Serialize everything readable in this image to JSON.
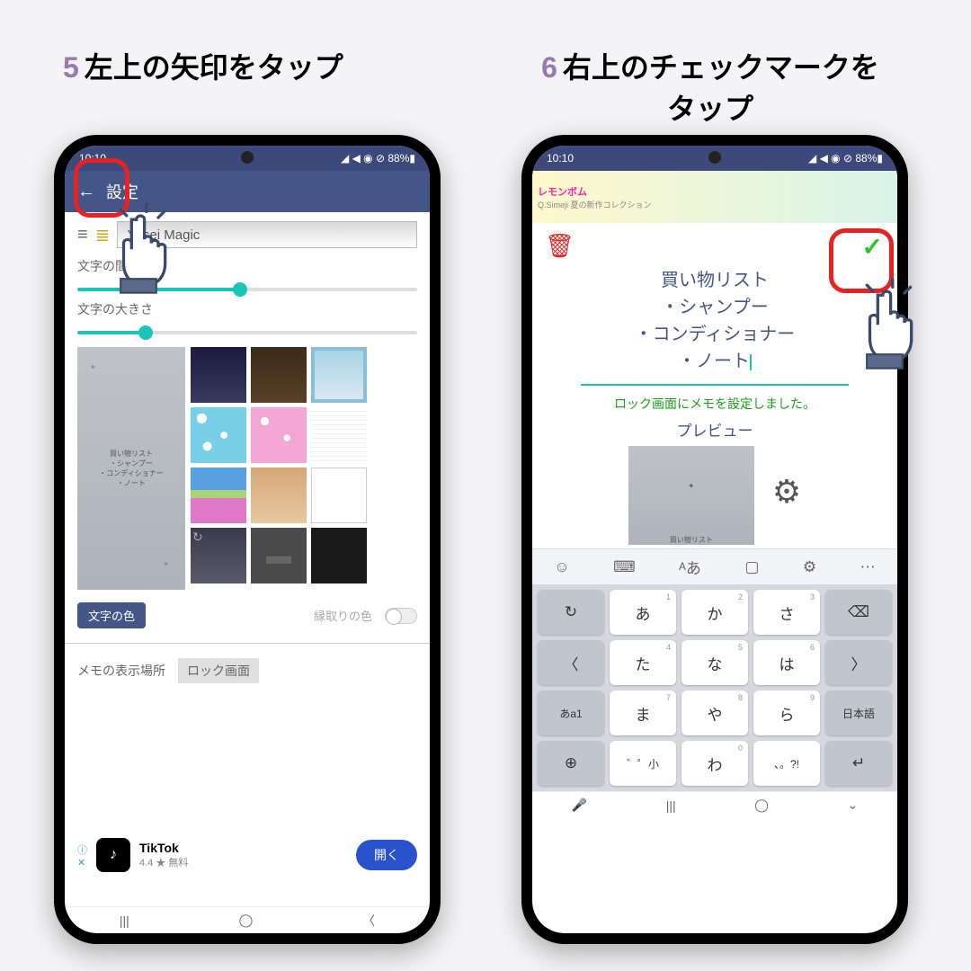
{
  "step5": {
    "num": "5",
    "title": "左上の矢印をタップ"
  },
  "step6": {
    "num": "6",
    "title": "右上のチェックマークを",
    "title2": "タップ"
  },
  "status": {
    "time": "10:10",
    "icons": "◢ ◀ ◉ ⊘ 88%▮"
  },
  "settings": {
    "title": "設定",
    "font_name": "Yusei Magic",
    "label_space": "文字の間隔",
    "label_size": "文字の大きさ",
    "text_color": "文字の色",
    "outline_color": "縁取りの色",
    "memo_loc_label": "メモの表示場所",
    "memo_loc_value": "ロック画面",
    "preview_text": "買い物リスト\n・シャンプー\n・コンディショナー\n・ノート"
  },
  "ad": {
    "name": "TikTok",
    "sub": "4.4 ★ 無料",
    "btn": "開く"
  },
  "note": {
    "title": "買い物リスト",
    "l1": "・シャンプー",
    "l2": "・コンディショナー",
    "l3": "・ノート",
    "success": "ロック画面にメモを設定しました。",
    "preview": "プレビュー",
    "preview_text": "買い物リスト"
  },
  "banner": {
    "brand": "レモンボム",
    "sub": "Q.Simeji 夏の新作コレクション"
  },
  "kbd": {
    "row1": [
      "↻",
      "あ",
      "か",
      "さ",
      "⌫"
    ],
    "sup1": [
      "",
      "1",
      "2",
      "3",
      ""
    ],
    "row2": [
      "〈",
      "た",
      "な",
      "は",
      "〉"
    ],
    "sup2": [
      "",
      "4",
      "5",
      "6",
      ""
    ],
    "row3": [
      "あa1",
      "ま",
      "や",
      "ら",
      "日本語"
    ],
    "sup3": [
      "",
      "7",
      "8",
      "9",
      ""
    ],
    "row4": [
      "⊕",
      "゛゜小",
      "わ",
      "、。?!",
      "↵"
    ],
    "sup4": [
      "",
      "",
      "0",
      "",
      ""
    ]
  }
}
